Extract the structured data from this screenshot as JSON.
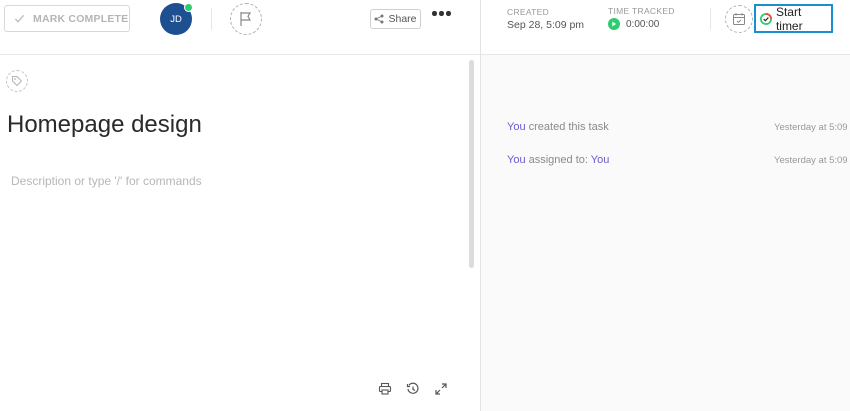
{
  "toolbar": {
    "mark_complete_label": "MARK COMPLETE",
    "avatar_initials": "JD",
    "share_label": "Share"
  },
  "task": {
    "title": "Homepage design",
    "description_placeholder": "Description or type '/' for commands"
  },
  "meta": {
    "created_label": "CREATED",
    "created_value": "Sep 28, 5:09 pm",
    "time_tracked_label": "TIME TRACKED",
    "time_tracked_value": "0:00:00",
    "start_timer_label": "Start timer"
  },
  "activity": [
    {
      "actor": "You",
      "text": " created this task",
      "target": "",
      "time": "Yesterday at 5:09"
    },
    {
      "actor": "You",
      "text": " assigned to: ",
      "target": "You",
      "time": "Yesterday at 5:09"
    }
  ],
  "colors": {
    "accent": "#6a5acd",
    "avatar": "#1d4f91",
    "status_green": "#2ecc71",
    "timer_border": "#1a8fcf"
  }
}
